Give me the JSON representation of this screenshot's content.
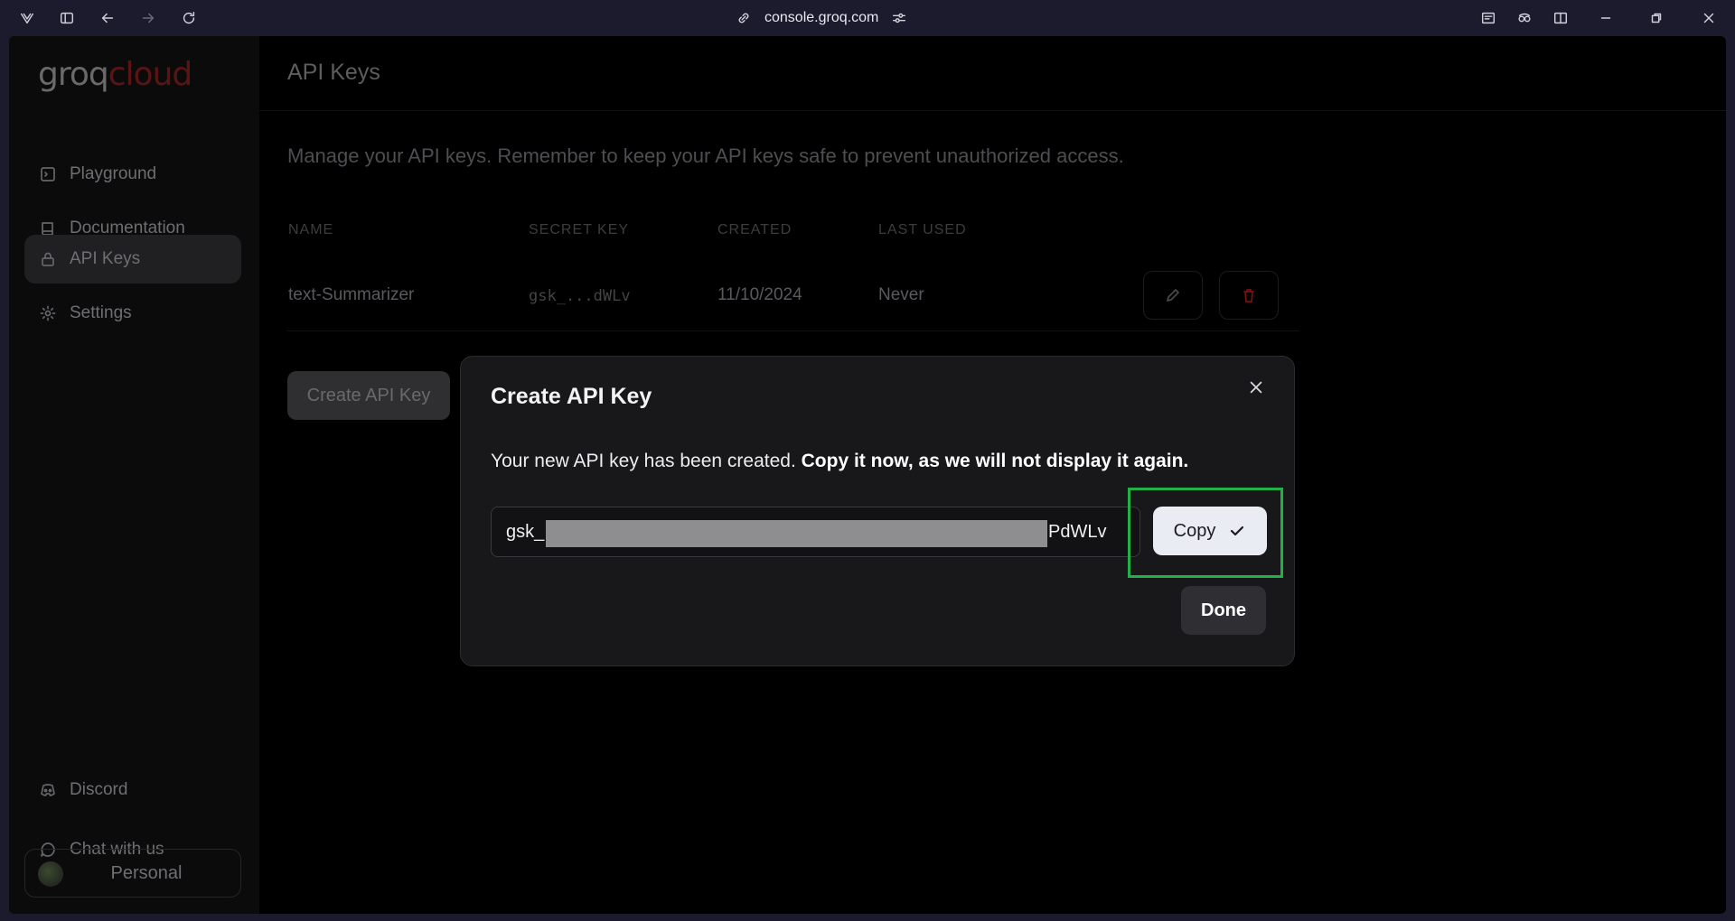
{
  "browser": {
    "url": "console.groq.com"
  },
  "logo": {
    "part1": "groq",
    "part2": "cloud"
  },
  "sidebar": {
    "items": [
      {
        "label": "Playground"
      },
      {
        "label": "Documentation"
      },
      {
        "label": "API Keys"
      },
      {
        "label": "Settings"
      }
    ],
    "bottom": [
      {
        "label": "Discord"
      },
      {
        "label": "Chat with us"
      }
    ],
    "profile": "Personal"
  },
  "main": {
    "title": "API Keys",
    "description": "Manage your API keys. Remember to keep your API keys safe to prevent unauthorized access.",
    "table": {
      "headers": [
        "NAME",
        "SECRET KEY",
        "CREATED",
        "LAST USED"
      ],
      "rows": [
        {
          "name": "text-Summarizer",
          "secret": "gsk_...dWLv",
          "created": "11/10/2024",
          "last_used": "Never"
        }
      ]
    },
    "create_label": "Create API Key"
  },
  "modal": {
    "title": "Create API Key",
    "message": "Your new API key has been created.",
    "message_bold": "Copy it now, as we will not display it again.",
    "key_prefix": "gsk_",
    "key_suffix": "PdWLv",
    "copy_label": "Copy",
    "done_label": "Done"
  },
  "colors": {
    "highlight": "#22b048",
    "delete": "#7a1010"
  }
}
